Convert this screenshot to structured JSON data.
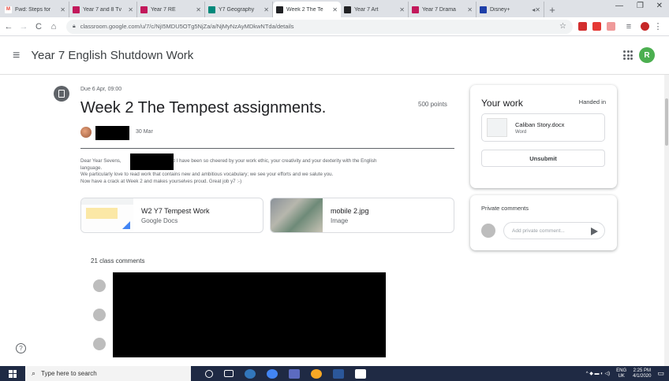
{
  "browser": {
    "tabs": [
      {
        "label": "Fwd: Steps for",
        "fav_color": "#ea4335",
        "fav_char": "M"
      },
      {
        "label": "Year 7 and 8 Tv",
        "fav_color": "#c2185b",
        "fav_char": ""
      },
      {
        "label": "Year 7 RE",
        "fav_color": "#c2185b",
        "fav_char": ""
      },
      {
        "label": "Y7 Geography",
        "fav_color": "#00897b",
        "fav_char": ""
      },
      {
        "label": "Week 2 The Te",
        "fav_color": "#202124",
        "fav_char": "",
        "active": true
      },
      {
        "label": "Year 7 Art",
        "fav_color": "#202124",
        "fav_char": ""
      },
      {
        "label": "Year 7 Drama",
        "fav_color": "#c2185b",
        "fav_char": ""
      },
      {
        "label": "Disney+",
        "fav_color": "#1e3fa8",
        "fav_char": ""
      }
    ],
    "url": "classroom.google.com/u/7/c/NjI5MDU5OTg5NjZa/a/NjMyNzAyMDkwNTda/details"
  },
  "header": {
    "title": "Year 7 English Shutdown Work",
    "avatar_letter": "R"
  },
  "assignment": {
    "due": "Due 6 Apr, 09:00",
    "title": "Week 2 The Tempest assignments.",
    "points": "500 points",
    "post_date": "30 Mar",
    "body": {
      "line1_a": "Dear Year Sevens,",
      "line1_b": "and I have been so cheered by your work ethic, your creativity and your dexterity with the English",
      "line2": "language.",
      "line3": "We particularly love to read work that contains new and ambitious vocabulary; we see your efforts and we salute you.",
      "line4": "Now have a crack at Week 2 and makes yourselves proud. Great job y7 :-)"
    },
    "attachments": [
      {
        "name": "W2 Y7 Tempest Work",
        "type": "Google Docs"
      },
      {
        "name": "mobile 2.jpg",
        "type": "Image"
      }
    ],
    "comments_label": "21 class comments"
  },
  "your_work": {
    "title": "Your work",
    "status": "Handed in",
    "file_name": "Caliban Story.docx",
    "file_type": "Word",
    "unsubmit_label": "Unsubmit"
  },
  "private_comments": {
    "title": "Private comments",
    "placeholder": "Add private comment..."
  },
  "taskbar": {
    "search_placeholder": "Type here to search",
    "lang": "ENG",
    "region": "UK",
    "time": "2:25 PM",
    "date": "4/1/2020"
  },
  "colors": {
    "accent_green": "#4caf50",
    "taskbar": "#1f2a44"
  }
}
